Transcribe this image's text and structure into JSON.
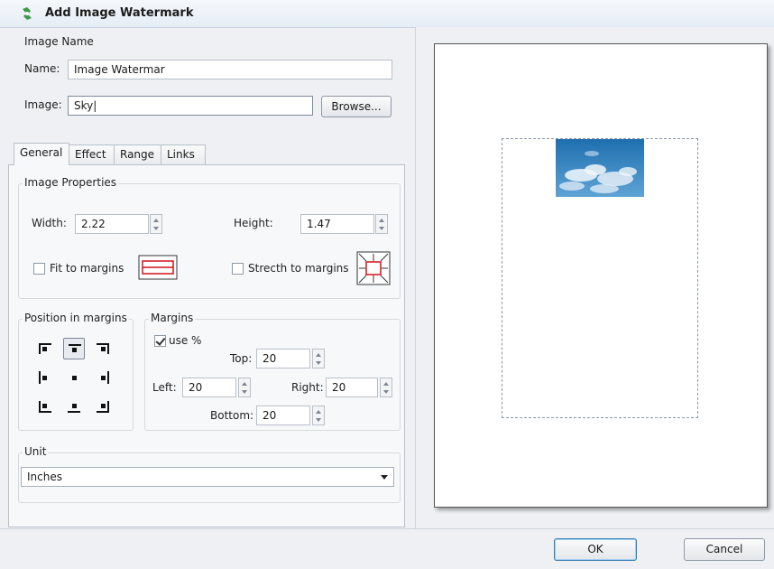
{
  "window": {
    "title": "Add Image Watermark"
  },
  "image_name": {
    "group_label": "Image Name",
    "name_label": "Name:",
    "name_value": "Image Watermar",
    "image_label": "Image:",
    "image_value": "Sky|",
    "browse_label": "Browse..."
  },
  "tabs": [
    {
      "label": "General"
    },
    {
      "label": "Effect"
    },
    {
      "label": "Range"
    },
    {
      "label": "Links"
    }
  ],
  "image_properties": {
    "group_label": "Image Properties",
    "width_label": "Width:",
    "width_value": "2.22",
    "height_label": "Height:",
    "height_value": "1.47",
    "fit_label": "Fit to margins",
    "fit_checked": false,
    "stretch_label": "Strecth to margins",
    "stretch_checked": false
  },
  "position": {
    "group_label": "Position in margins",
    "selected": "top-center"
  },
  "margins": {
    "group_label": "Margins",
    "use_percent_label": "use %",
    "use_percent_checked": true,
    "top_label": "Top:",
    "top_value": "20",
    "left_label": "Left:",
    "left_value": "20",
    "right_label": "Right:",
    "right_value": "20",
    "bottom_label": "Bottom:",
    "bottom_value": "20"
  },
  "unit": {
    "group_label": "Unit",
    "selected": "Inches"
  },
  "footer": {
    "ok_label": "OK",
    "cancel_label": "Cancel"
  },
  "colors": {
    "accent_red": "#d0101a",
    "dialog_bg": "#eef0f3",
    "group_bg": "#f7f8fa"
  }
}
